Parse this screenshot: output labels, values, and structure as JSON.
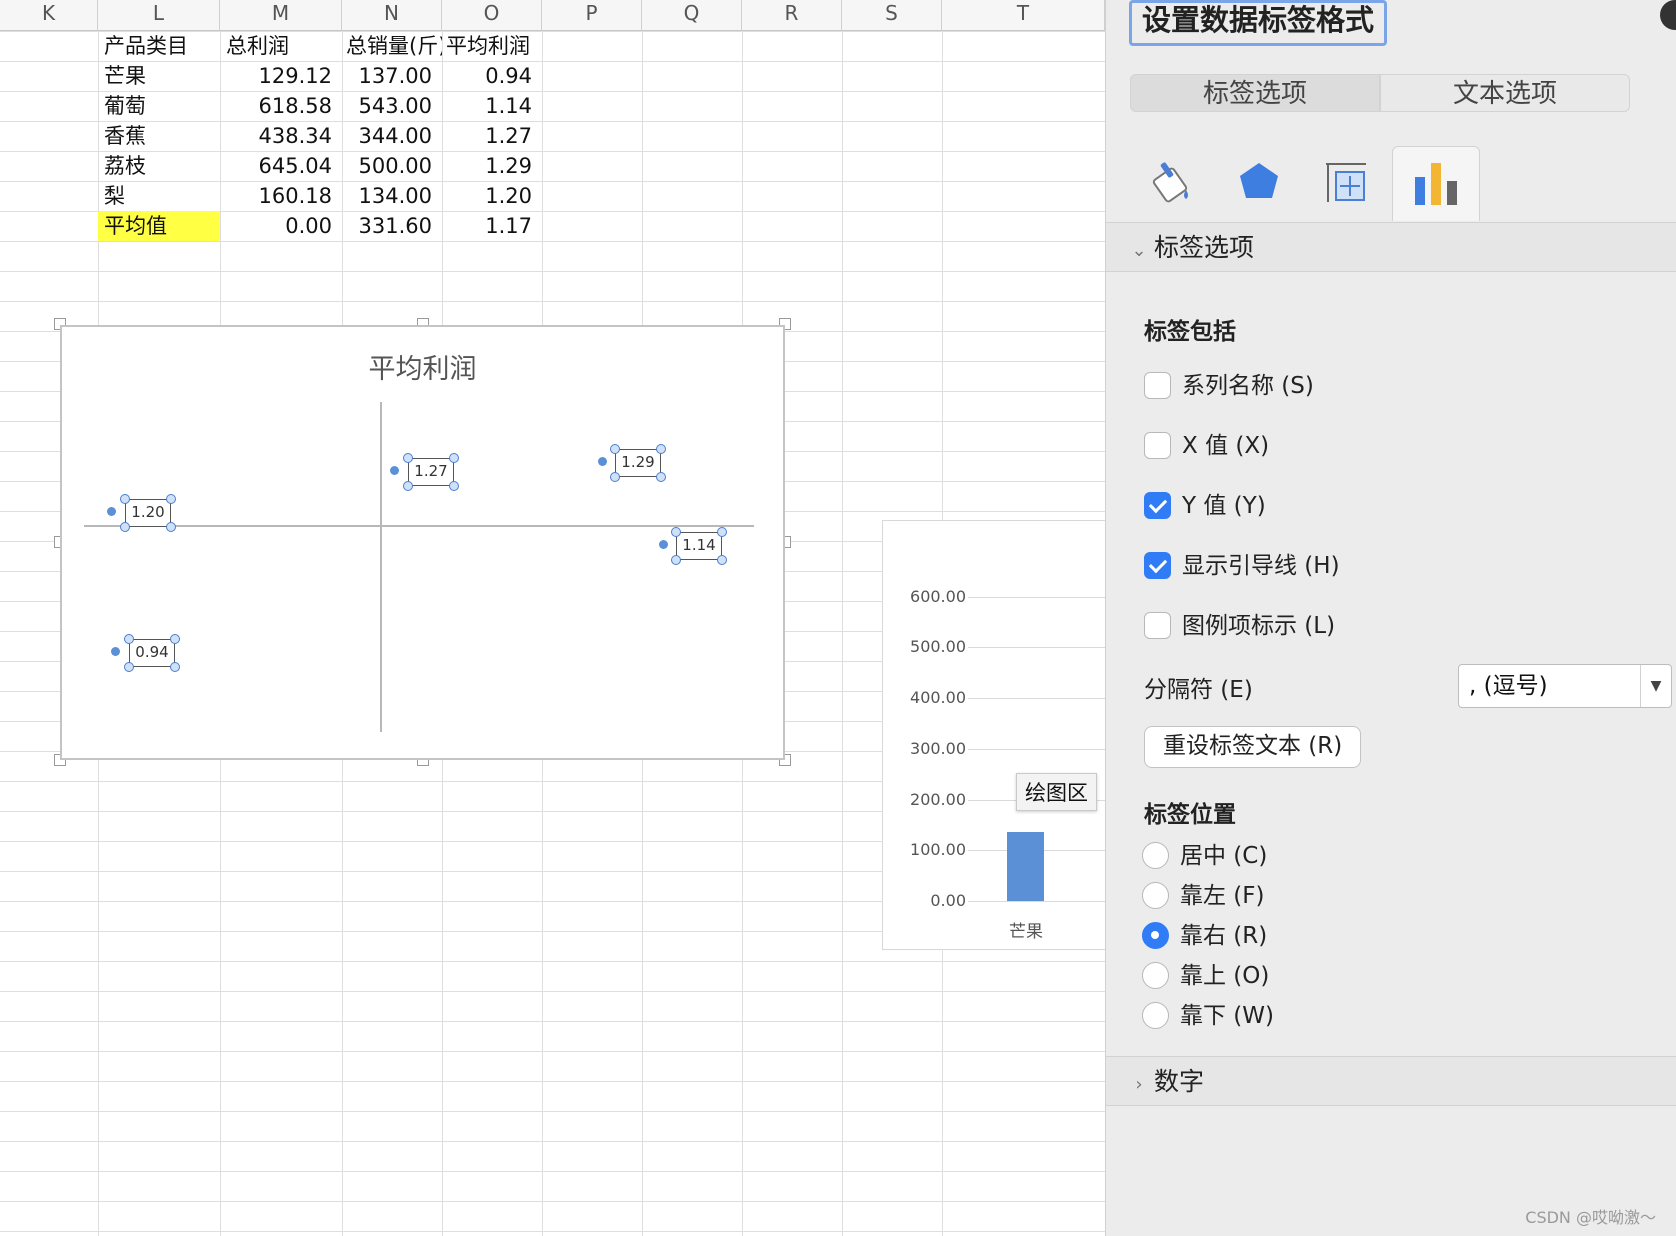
{
  "sheet": {
    "columns": [
      "K",
      "L",
      "M",
      "N",
      "O",
      "P",
      "Q",
      "R",
      "S",
      "T"
    ],
    "table": {
      "headers": [
        "产品类目",
        "总利润",
        "总销量(斤)",
        "平均利润"
      ],
      "rows": [
        [
          "芒果",
          "129.12",
          "137.00",
          "0.94"
        ],
        [
          "葡萄",
          "618.58",
          "543.00",
          "1.14"
        ],
        [
          "香蕉",
          "438.34",
          "344.00",
          "1.27"
        ],
        [
          "荔枝",
          "645.04",
          "500.00",
          "1.29"
        ],
        [
          "梨",
          "160.18",
          "134.00",
          "1.20"
        ],
        [
          "平均值",
          "0.00",
          "331.60",
          "1.17"
        ]
      ],
      "highlight_color": "#ffff44"
    }
  },
  "chart_data": [
    {
      "type": "scatter",
      "title": "平均利润",
      "series": [
        {
          "points": [
            {
              "label": "1.20"
            },
            {
              "label": "1.27"
            },
            {
              "label": "1.29"
            },
            {
              "label": "1.14"
            },
            {
              "label": "0.94"
            }
          ]
        }
      ],
      "data_labels": true,
      "label_position": "right",
      "leader_lines": true,
      "color": "#5b8fd6"
    },
    {
      "type": "bar",
      "categories": [
        "芒果"
      ],
      "values": [
        137.0
      ],
      "yticks": [
        "600.00",
        "500.00",
        "400.00",
        "300.00",
        "200.00",
        "100.00",
        "0.00"
      ],
      "ylim": [
        0,
        600
      ],
      "color": "#5b8fd6"
    }
  ],
  "tooltip": "绘图区",
  "pane": {
    "title": "设置数据标签格式",
    "tabs": [
      "标签选项",
      "文本选项"
    ],
    "section_label_options": "标签选项",
    "group_includes": "标签包括",
    "checkboxes": [
      {
        "label": "系列名称 (S)",
        "checked": false
      },
      {
        "label": "X 值 (X)",
        "checked": false
      },
      {
        "label": "Y 值 (Y)",
        "checked": true
      },
      {
        "label": "显示引导线 (H)",
        "checked": true
      },
      {
        "label": "图例项标示 (L)",
        "checked": false
      }
    ],
    "separator_label": "分隔符 (E)",
    "separator_value": ", (逗号)",
    "reset_button": "重设标签文本 (R)",
    "group_position": "标签位置",
    "positions": [
      {
        "label": "居中 (C)",
        "checked": false
      },
      {
        "label": "靠左 (F)",
        "checked": false
      },
      {
        "label": "靠右 (R)",
        "checked": true
      },
      {
        "label": "靠上 (O)",
        "checked": false
      },
      {
        "label": "靠下 (W)",
        "checked": false
      }
    ],
    "section_number": "数字",
    "accent": "#2f7cf6"
  },
  "watermark": "CSDN @哎呦激～"
}
